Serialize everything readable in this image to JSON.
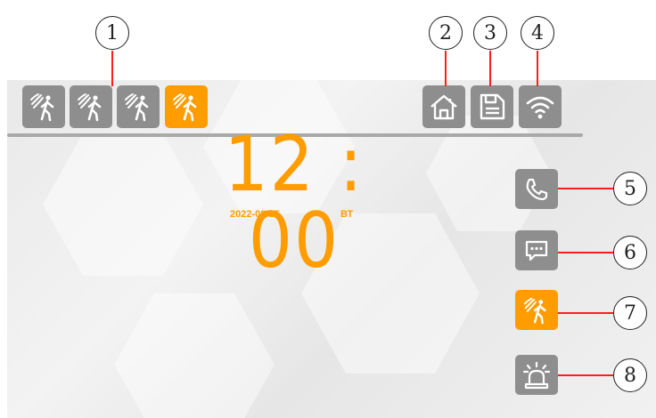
{
  "clock": {
    "time": "12 : 00",
    "date": "2022-08-25",
    "weekday": "ВТ"
  },
  "colors": {
    "accent": "#ff9c00",
    "button_gray": "#8e8e8e",
    "callout_line": "#ff1e1e"
  },
  "top_bar": {
    "motion_icons": [
      {
        "icon": "motion-sensor-icon",
        "state": "inactive"
      },
      {
        "icon": "motion-sensor-icon",
        "state": "inactive"
      },
      {
        "icon": "motion-sensor-icon",
        "state": "inactive"
      },
      {
        "icon": "motion-sensor-icon",
        "state": "active"
      }
    ],
    "status_icons": [
      "home-icon",
      "sd-card-icon",
      "wifi-icon"
    ]
  },
  "side_menu": [
    "phone-icon",
    "message-icon",
    "motion-sensor-icon",
    "alarm-icon"
  ],
  "callouts": [
    "1",
    "2",
    "3",
    "4",
    "5",
    "6",
    "7",
    "8"
  ]
}
